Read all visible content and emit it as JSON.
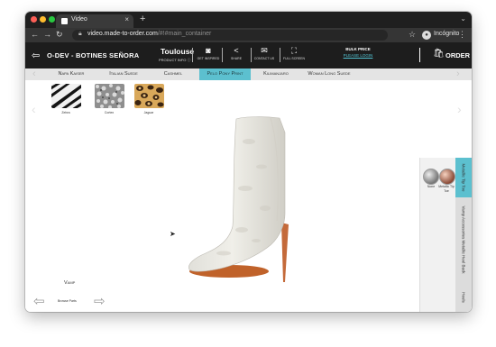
{
  "browser": {
    "tab_title": "Video",
    "tab_close": "×",
    "new_tab": "+",
    "url_host": "video.made-to-order.com",
    "url_path": "/#!#main_container",
    "profile_label": "Incógnito"
  },
  "header": {
    "brand": "O-DEV - BOTINES SEÑORA",
    "model_name": "Toulouse",
    "product_info_label": "PRODUCT INFO",
    "actions": [
      {
        "label": "GET INSPIRED",
        "icon": "camera-icon"
      },
      {
        "label": "SHARE",
        "icon": "share-icon"
      },
      {
        "label": "CONTACT US",
        "icon": "envelope-icon"
      },
      {
        "label": "FULL SCREEN",
        "icon": "fullscreen-icon"
      }
    ],
    "bulk_price": "BULK PRICE",
    "login_link": "PLEASE LOGIN",
    "order_label": "ORDER"
  },
  "materials": {
    "items": [
      "Napa Kaiser",
      "Italian Suede",
      "Cashmel",
      "Pelo Pony Print",
      "Kilimanjaro",
      "Woman Long Suede"
    ],
    "active_index": 3
  },
  "swatches": [
    {
      "label": "Zebra"
    },
    {
      "label": "Cortex"
    },
    {
      "label": "Jaguar"
    }
  ],
  "parts": {
    "current_part": "Vamp",
    "browse_label": "Browse Parts"
  },
  "finishes": [
    {
      "label": "None"
    },
    {
      "label": "Metallic Tip Toe"
    }
  ],
  "side_tabs": [
    "Metallic Tip Toe",
    "Vamp Accessories Metallic Heel Back",
    "Heels"
  ],
  "colors": {
    "accent": "#5cc0cf",
    "header_bg": "#1d1d1d",
    "material_bar_bg": "#e4e4e4"
  }
}
